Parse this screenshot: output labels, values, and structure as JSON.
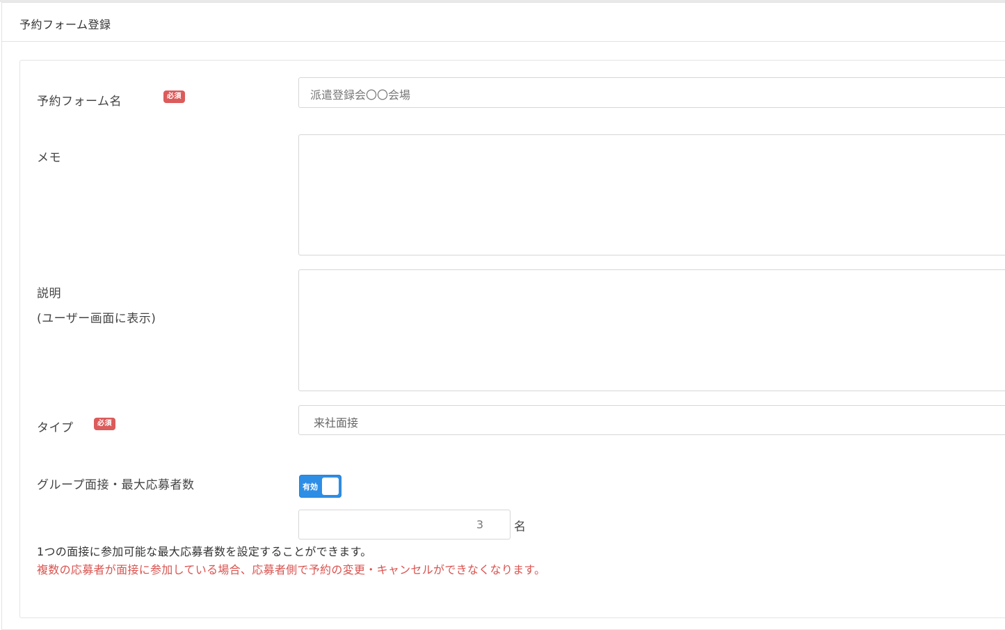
{
  "header": {
    "title": "予約フォーム登録"
  },
  "form": {
    "required_badge": "必須",
    "name": {
      "label": "予約フォーム名",
      "placeholder": "派遣登録会〇〇会場"
    },
    "memo": {
      "label": "メモ",
      "value": ""
    },
    "description": {
      "label": "説明",
      "sublabel": "(ユーザー画面に表示)",
      "value": ""
    },
    "type": {
      "label": "タイプ",
      "value": "来社面接"
    },
    "group_interview": {
      "label": "グループ面接・最大応募者数",
      "toggle_label": "有効",
      "toggle_on": true,
      "max_value": "3",
      "unit": "名"
    },
    "help_text": "1つの面接に参加可能な最大応募者数を設定することができます。",
    "warning_text": "複数の応募者が面接に参加している場合、応募者側で予約の変更・キャンセルができなくなります。"
  },
  "colors": {
    "badge": "#dc5b5b",
    "toggle": "#2e8ee6",
    "warning": "#d9534f"
  }
}
